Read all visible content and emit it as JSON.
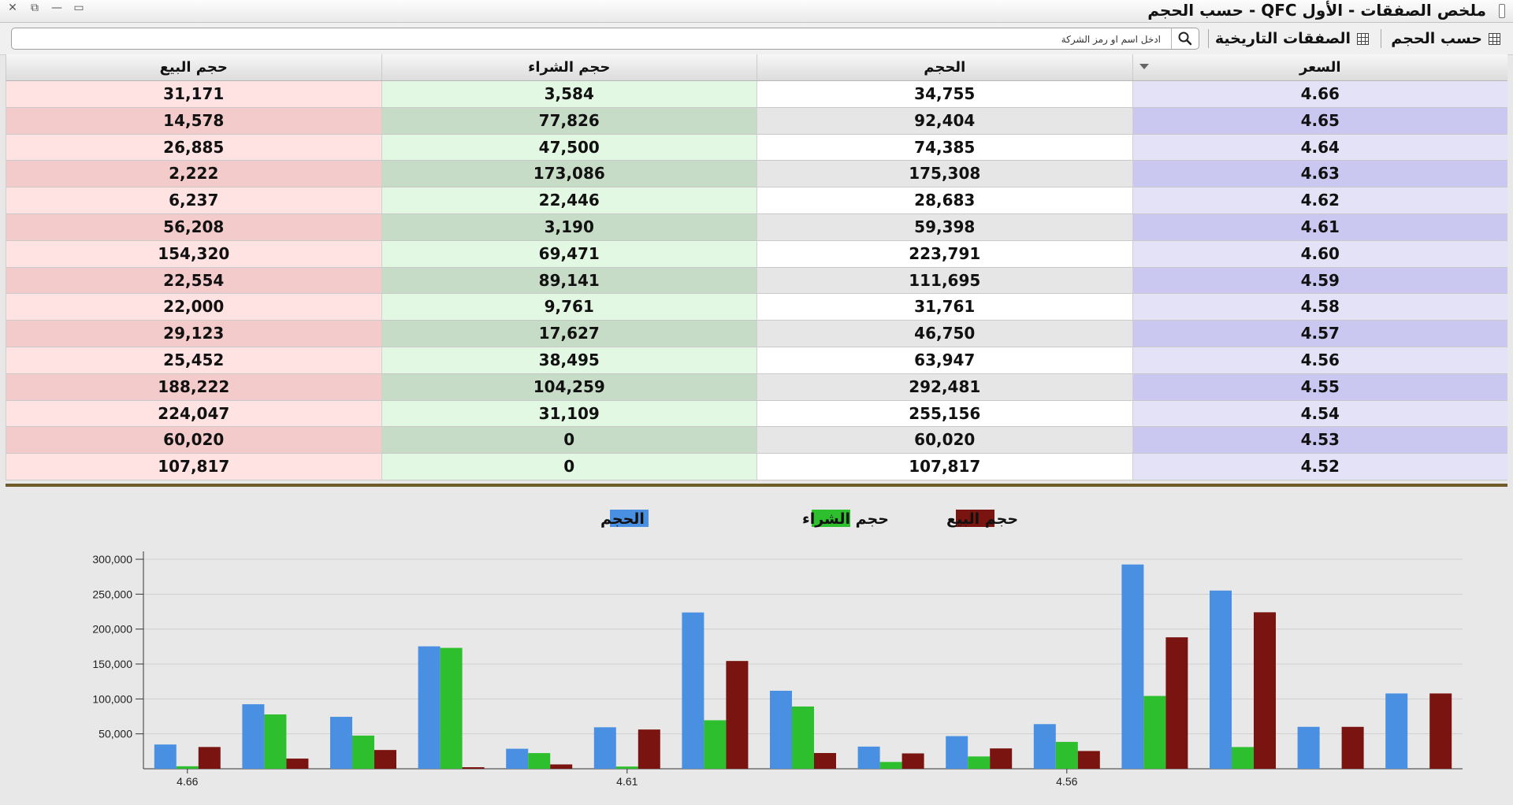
{
  "window": {
    "title": "ملخص الصفقات - الأول QFC - حسب الحجم",
    "controls": [
      "✕",
      "⧉",
      "—",
      "▭"
    ]
  },
  "toolbar": {
    "by_volume": "حسب الحجم",
    "historical": "الصفقات التاريخية",
    "search_placeholder": "ادخل اسم او رمز الشركة"
  },
  "table": {
    "headers": {
      "price": "السعر",
      "volume": "الحجم",
      "buy_volume": "حجم الشراء",
      "sell_volume": "حجم البيع"
    },
    "rows": [
      {
        "price": "4.66",
        "volume": "34,755",
        "buy": "3,584",
        "sell": "31,171"
      },
      {
        "price": "4.65",
        "volume": "92,404",
        "buy": "77,826",
        "sell": "14,578"
      },
      {
        "price": "4.64",
        "volume": "74,385",
        "buy": "47,500",
        "sell": "26,885"
      },
      {
        "price": "4.63",
        "volume": "175,308",
        "buy": "173,086",
        "sell": "2,222"
      },
      {
        "price": "4.62",
        "volume": "28,683",
        "buy": "22,446",
        "sell": "6,237"
      },
      {
        "price": "4.61",
        "volume": "59,398",
        "buy": "3,190",
        "sell": "56,208"
      },
      {
        "price": "4.60",
        "volume": "223,791",
        "buy": "69,471",
        "sell": "154,320"
      },
      {
        "price": "4.59",
        "volume": "111,695",
        "buy": "89,141",
        "sell": "22,554"
      },
      {
        "price": "4.58",
        "volume": "31,761",
        "buy": "9,761",
        "sell": "22,000"
      },
      {
        "price": "4.57",
        "volume": "46,750",
        "buy": "17,627",
        "sell": "29,123"
      },
      {
        "price": "4.56",
        "volume": "63,947",
        "buy": "38,495",
        "sell": "25,452"
      },
      {
        "price": "4.55",
        "volume": "292,481",
        "buy": "104,259",
        "sell": "188,222"
      },
      {
        "price": "4.54",
        "volume": "255,156",
        "buy": "31,109",
        "sell": "224,047"
      },
      {
        "price": "4.53",
        "volume": "60,020",
        "buy": "0",
        "sell": "60,020"
      },
      {
        "price": "4.52",
        "volume": "107,817",
        "buy": "0",
        "sell": "107,817"
      }
    ]
  },
  "colors": {
    "volume": "#4a90e2",
    "buy": "#2ebf2e",
    "sell": "#7a1410"
  },
  "chart_data": {
    "type": "bar",
    "categories": [
      "4.66",
      "4.65",
      "4.64",
      "4.63",
      "4.62",
      "4.61",
      "4.60",
      "4.59",
      "4.58",
      "4.57",
      "4.56",
      "4.55",
      "4.54",
      "4.53",
      "4.52"
    ],
    "tick_labels_shown": [
      "4.66",
      "4.61",
      "4.56"
    ],
    "series": [
      {
        "name": "الحجم",
        "color": "#4a90e2",
        "values": [
          34755,
          92404,
          74385,
          175308,
          28683,
          59398,
          223791,
          111695,
          31761,
          46750,
          63947,
          292481,
          255156,
          60020,
          107817
        ]
      },
      {
        "name": "حجم الشراء",
        "color": "#2ebf2e",
        "values": [
          3584,
          77826,
          47500,
          173086,
          22446,
          3190,
          69471,
          89141,
          9761,
          17627,
          38495,
          104259,
          31109,
          0,
          0
        ]
      },
      {
        "name": "حجم البيع",
        "color": "#7a1410",
        "values": [
          31171,
          14578,
          26885,
          2222,
          6237,
          56208,
          154320,
          22554,
          22000,
          29123,
          25452,
          188222,
          224047,
          60020,
          107817
        ]
      }
    ],
    "legend_order": [
      "حجم البيع",
      "حجم الشراء",
      "الحجم"
    ],
    "y_ticks": [
      50000,
      100000,
      150000,
      200000,
      250000,
      300000
    ],
    "y_tick_labels": [
      "50,000",
      "100,000",
      "150,000",
      "200,000",
      "250,000",
      "300,000"
    ],
    "ylim": [
      0,
      300000
    ],
    "grid": true,
    "legend_position": "top-center"
  }
}
